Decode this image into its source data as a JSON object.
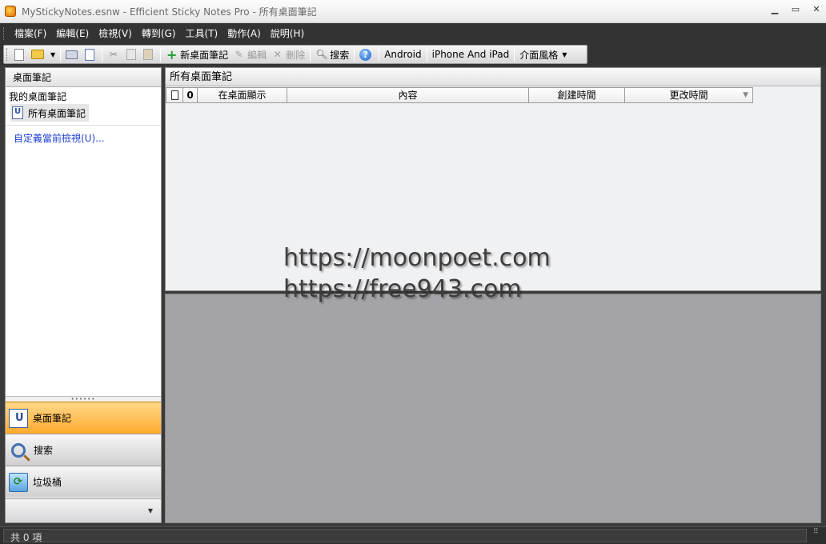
{
  "window": {
    "title": "MyStickyNotes.esnw - Efficient Sticky Notes Pro - 所有桌面筆記",
    "minimize": "▁",
    "maximize": "▭",
    "close": "✕"
  },
  "menu": [
    "檔案(F)",
    "編輯(E)",
    "檢視(V)",
    "轉到(G)",
    "工具(T)",
    "動作(A)",
    "說明(H)"
  ],
  "toolbar": {
    "new_note": "新桌面筆記",
    "edit": "編輯",
    "delete": "刪除",
    "search": "搜索",
    "android": "Android",
    "iphone": "iPhone And iPad",
    "theme": "介面風格"
  },
  "left_panel": {
    "header": "桌面筆記",
    "tree_root": "我的桌面筆記",
    "tree_item": "所有桌面筆記",
    "custom_link": "自定義當前檢視(U)..."
  },
  "nav": {
    "notes": "桌面筆記",
    "search": "搜索",
    "trash": "垃圾桶"
  },
  "right_panel": {
    "header": "所有桌面筆記",
    "columns": [
      "在桌面顯示",
      "內容",
      "創建時間",
      "更改時間"
    ]
  },
  "watermark": {
    "line1": "https://moonpoet.com",
    "line2": "https://free943.com"
  },
  "status": {
    "text": "共 0 項"
  }
}
